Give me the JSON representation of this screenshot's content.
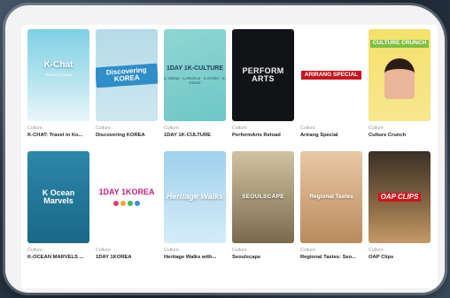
{
  "cards": [
    {
      "category": "Culture",
      "title": "K-CHAT: Travel in Ko...",
      "thumb_text": "K-Chat",
      "thumb_sub": "Travel in Korea"
    },
    {
      "category": "Culture",
      "title": "Discovering KOREA",
      "thumb_text": "Discovering KOREA"
    },
    {
      "category": "Culture",
      "title": "1DAY 1K-CULTURE",
      "thumb_text": "1DAY 1K-CULTURE",
      "thumb_sub": "K-TREND · K-PEOPLE · K-STORY · K-STAGE"
    },
    {
      "category": "Culture",
      "title": "PerformArts Reload",
      "thumb_text": "PERFORM ARTS"
    },
    {
      "category": "Culture",
      "title": "Arirang Special",
      "thumb_text": "ARIRANG SPECIAL"
    },
    {
      "category": "Culture",
      "title": "Culture Crunch",
      "thumb_text": "CULTURE CRUNCH"
    },
    {
      "category": "Culture",
      "title": "K-OCEAN MARVELS ...",
      "thumb_text": "K Ocean Marvels"
    },
    {
      "category": "Culture",
      "title": "1DAY 1KOREA",
      "thumb_text": "1DAY 1KOREA"
    },
    {
      "category": "Culture",
      "title": "Heritage Walks with...",
      "thumb_text": "Heritage Walks"
    },
    {
      "category": "Culture",
      "title": "Seoulscape",
      "thumb_text": "SEOULSCAPE"
    },
    {
      "category": "Culture",
      "title": "Regional Tastes: Seo...",
      "thumb_text": "Regional Tastes"
    },
    {
      "category": "Culture",
      "title": "OAP Clips",
      "thumb_text": "OAP CLIPS"
    }
  ],
  "colors": {
    "accent_red": "#c8161e",
    "title_text": "#222222",
    "category_text": "#9a9a9a"
  }
}
